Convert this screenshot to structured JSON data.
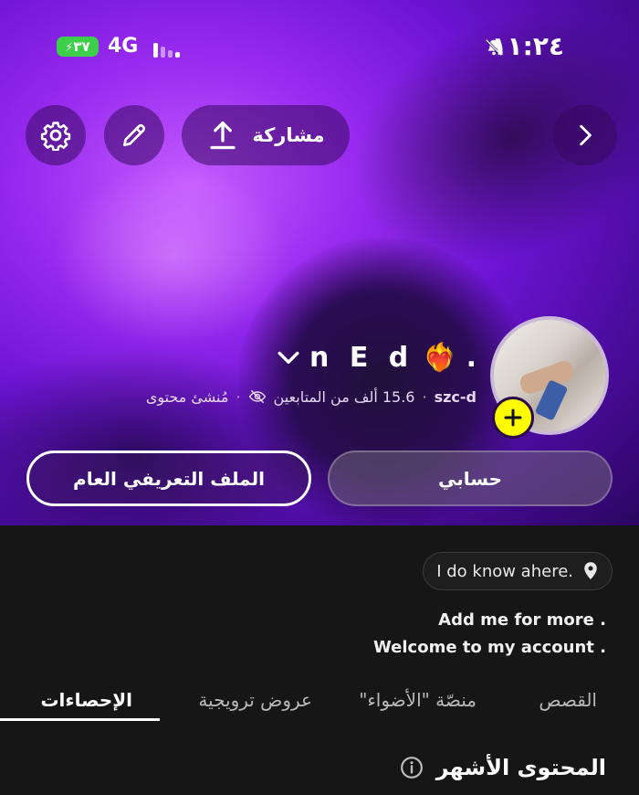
{
  "status_bar": {
    "battery": "٣٧",
    "network": "4G",
    "time": "١١:٢٤",
    "icons": [
      "bolt-icon",
      "signal-bars-icon",
      "bell-muted-icon"
    ]
  },
  "toolbar": {
    "share_label": "مشاركة",
    "icons": [
      "gear-icon",
      "pencil-icon",
      "upload-icon",
      "chevron-right-icon"
    ]
  },
  "profile": {
    "name_letters": "n E d",
    "name_suffix": ".",
    "username": "szc-d",
    "followers": "15.6 ألف من المتابعين",
    "role": "مُنشئ محتوى",
    "separator": "·",
    "emoji": "❤️‍🔥"
  },
  "buttons": {
    "account": "حسابي",
    "public_profile": "الملف التعريفي العام"
  },
  "location": {
    "text": "I do know ahere."
  },
  "bio": {
    "line1": "Add me for more .",
    "line2": "Welcome to my account ."
  },
  "tabs": [
    {
      "label": "القصص",
      "active": false
    },
    {
      "label": "منصّة \"الأضواء\"",
      "active": false
    },
    {
      "label": "عروض ترويجية",
      "active": false
    },
    {
      "label": "الإحصاءات",
      "active": true
    }
  ],
  "section": {
    "title": "المحتوى الأشهر"
  },
  "colors": {
    "accent_yellow": "#fffc00",
    "battery_green": "#3ecf4a",
    "hero_purple": "#7a18de",
    "background": "#161616"
  }
}
